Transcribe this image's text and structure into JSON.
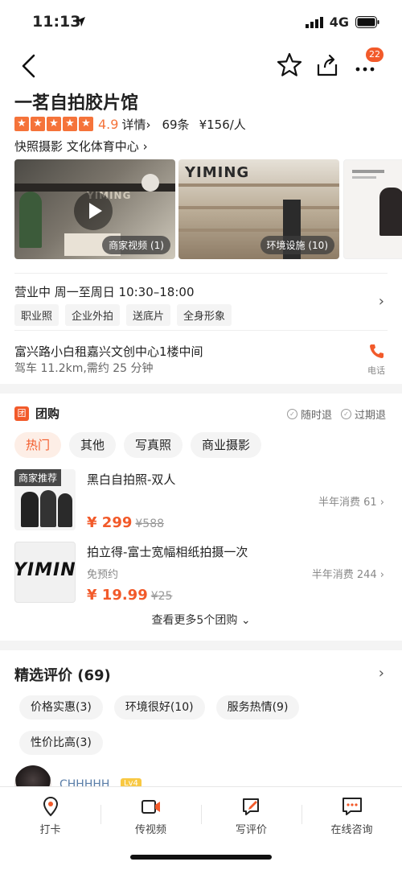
{
  "status": {
    "time": "11:13",
    "network": "4G"
  },
  "nav": {
    "badge_count": "22"
  },
  "shop": {
    "name": "一茗自拍胶片馆",
    "score": "4.9",
    "detail_link": "详情",
    "review_count": "69条",
    "price": "¥156/人",
    "category": "快照摄影  文化体育中心"
  },
  "gallery": {
    "video_caption": "商家视频 (1)",
    "env_caption": "环境设施 (10)",
    "img1_text": "YIMING",
    "img2_text": "YIMING"
  },
  "hours": {
    "text": "营业中  周一至周日 10:30–18:00",
    "tags": [
      "职业照",
      "企业外拍",
      "送底片",
      "全身形象"
    ]
  },
  "address": {
    "line": "富兴路小白租嘉兴文创中心1楼中间",
    "drive": "驾车 11.2km,需约 25 分钟",
    "phone_label": "电话"
  },
  "group_buy": {
    "icon_text": "团",
    "title": "团购",
    "refund_any": "随时退",
    "refund_expired": "过期退",
    "filters": [
      "热门",
      "其他",
      "写真照",
      "商业摄影"
    ],
    "deals": [
      {
        "name": "黑白自拍照-双人",
        "badge": "商家推荐",
        "sold": "半年消费 61",
        "price": "¥ 299",
        "orig": "¥588",
        "sub": ""
      },
      {
        "name": "拍立得-富士宽幅相纸拍摄一次",
        "badge": "",
        "sold": "半年消费 244",
        "price": "¥ 19.99",
        "orig": "¥25",
        "sub": "免预约",
        "img_text": "YIMING"
      }
    ],
    "more": "查看更多5个团购"
  },
  "reviews": {
    "title": "精选评价 (69)",
    "tags": [
      "价格实惠(3)",
      "环境很好(10)",
      "服务热情(9)",
      "性价比高(3)"
    ],
    "first_reviewer": "CHHHHH",
    "level": "Lv4"
  },
  "tabbar": {
    "items": [
      "打卡",
      "传视频",
      "写评价",
      "在线咨询"
    ]
  },
  "colors": {
    "accent": "#f25a2a",
    "star": "#f5733a"
  }
}
